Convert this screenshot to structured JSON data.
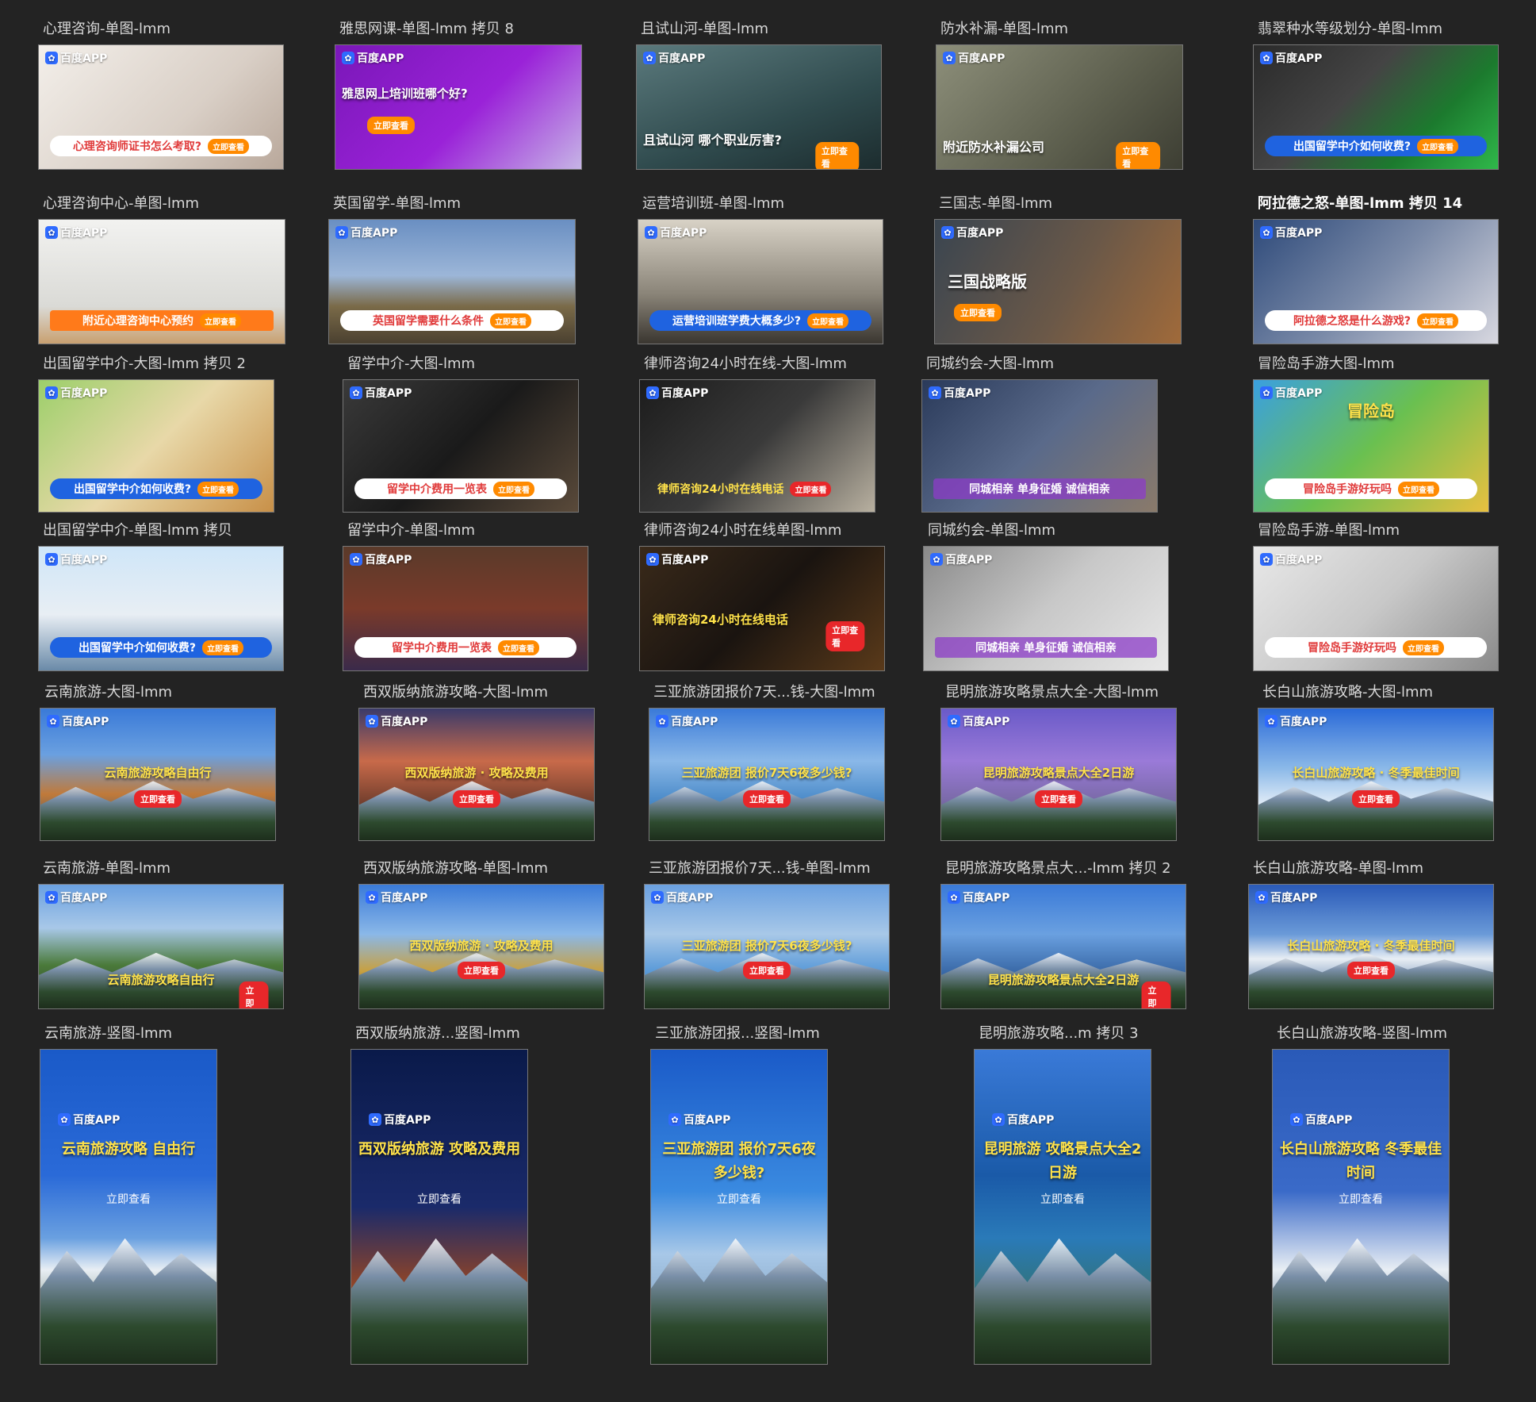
{
  "artboards": [
    {
      "label": "心理咨询-单图-lmm",
      "headline": "",
      "bar_text": "心理咨询师证书怎么考取?",
      "bar_style": "white",
      "cta": "立即查看",
      "bg": "linear-gradient(135deg,#f3efea,#d9cfc6 60%,#b9a89b)"
    },
    {
      "label": "雅思网课-单图-lmm 拷贝 8",
      "headline": "雅思网上培训班哪个好?",
      "bar_text": "",
      "cta": "立即查看",
      "bg": "linear-gradient(135deg,#7a17b8,#9a22d8 55%,#c6b4e6)"
    },
    {
      "label": "且试山河-单图-lmm",
      "headline": "且试山河  哪个职业厉害?",
      "bar_text": "",
      "cta": "立即查看",
      "bg": "linear-gradient(160deg,#5b7a7d,#2f4a4d 60%,#1c2c2e)"
    },
    {
      "label": "防水补漏-单图-lmm",
      "headline": "附近防水补漏公司",
      "bar_text": "",
      "cta": "立即查看",
      "bg": "linear-gradient(135deg,#8d8f7a,#5d5f4e 60%,#3d3e33)"
    },
    {
      "label": "翡翠种水等级划分-单图-lmm",
      "headline": "",
      "bar_text": "出国留学中介如何收费?",
      "bar_style": "blue",
      "cta": "立即查看",
      "bg": "linear-gradient(135deg,#2a2a2a,#444 40%,#1c7a2e 70%,#2fb84a)"
    },
    {
      "label": "心理咨询中心-单图-lmm",
      "headline": "",
      "bar_text": "附近心理咨询中心预约",
      "bar_style": "orange",
      "cta": "立即查看",
      "bg": "linear-gradient(180deg,#f2f2f0,#dadad6 70%,#c8a070)"
    },
    {
      "label": "英国留学-单图-lmm",
      "headline": "",
      "bar_text": "英国留学需要什么条件",
      "bar_style": "white",
      "cta": "立即查看",
      "bg": "linear-gradient(180deg,#6a8fc2,#9cb6d8 45%,#7a6a48 70%,#4a4030)"
    },
    {
      "label": "运营培训班-单图-lmm",
      "headline": "",
      "bar_text": "运营培训班学费大概多少?",
      "bar_style": "blue",
      "cta": "立即查看",
      "bg": "linear-gradient(180deg,#d8d2c6,#8a8478 60%,#3a3630)"
    },
    {
      "label": "三国志-单图-lmm",
      "headline": "三国战略版",
      "bar_text": "",
      "cta": "立即查看",
      "bg": "linear-gradient(120deg,#3a4550,#6a5848 55%,#a06a3a)"
    },
    {
      "label": "阿拉德之怒-单图-lmm 拷贝 14",
      "headline": "",
      "bar_text": "阿拉德之怒是什么游戏?",
      "bar_style": "white",
      "cta": "立即查看",
      "bg": "linear-gradient(135deg,#2e4a7a,#7a8aa8 50%,#d8d8e0)"
    },
    {
      "label": "出国留学中介-大图-lmm 拷贝 2",
      "headline": "",
      "bar_text": "出国留学中介如何收费?",
      "bar_style": "blue",
      "cta": "立即查看",
      "bg": "linear-gradient(135deg,#9ccf6a,#e8d8a8 50%,#c89048)"
    },
    {
      "label": "留学中介-大图-lmm",
      "headline": "",
      "bar_text": "留学中介费用一览表",
      "bar_style": "white",
      "cta": "立即查看",
      "bg": "linear-gradient(135deg,#3a3a3a,#1a1a1a 50%,#5a4a3a)"
    },
    {
      "label": "律师咨询24小时在线-大图-lmm",
      "headline": "",
      "bar_text": "律师咨询24小时在线电话",
      "bar_style": "red",
      "cta": "立即查看",
      "bg": "linear-gradient(135deg,#1c1c1c,#3a3a3a 50%,#b8b0a0)"
    },
    {
      "label": "同城约会-大图-lmm",
      "headline": "",
      "bar_text": "同城相亲  单身征婚  诚信相亲",
      "bar_style": "purple",
      "cta": "",
      "bg": "linear-gradient(135deg,#2a3a5a,#5a6a8a 50%,#8a7a6a)"
    },
    {
      "label": "冒险岛手游大图-lmm",
      "headline": "冒险岛",
      "bar_text": "冒险岛手游好玩吗",
      "bar_style": "white",
      "cta": "立即查看",
      "bg": "linear-gradient(135deg,#3aa0e0,#6ac050 50%,#e8c040)"
    },
    {
      "label": "出国留学中介-单图-lmm 拷贝",
      "headline": "",
      "bar_text": "出国留学中介如何收费?",
      "bar_style": "blue",
      "cta": "立即查看",
      "bg": "linear-gradient(180deg,#cfe6f8,#e8eef4 55%,#6a8aa8)"
    },
    {
      "label": "留学中介-单图-lmm",
      "headline": "",
      "bar_text": "留学中介费用一览表",
      "bar_style": "white",
      "cta": "立即查看",
      "bg": "linear-gradient(180deg,#5a3a2a,#7a3a2a 50%,#3a2a4a)"
    },
    {
      "label": "律师咨询24小时在线单图-lmm",
      "headline": "律师咨询24小时在线电话",
      "bar_text": "",
      "cta": "立即查看",
      "bg": "linear-gradient(135deg,#3a2a1a,#1a1410 50%,#5a3a1a)"
    },
    {
      "label": "同城约会-单图-lmm",
      "headline": "",
      "bar_text": "同城相亲  单身征婚  诚信相亲",
      "bar_style": "purple",
      "cta": "",
      "bg": "linear-gradient(135deg,#8a8a8a,#c8c8c8 50%,#e8e8e8)"
    },
    {
      "label": "冒险岛手游-单图-lmm",
      "headline": "",
      "bar_text": "冒险岛手游好玩吗",
      "bar_style": "white",
      "cta": "立即查看",
      "bg": "linear-gradient(135deg,#e8e8e8,#c8c8c8 50%,#8a8a8a)"
    },
    {
      "label": "云南旅游-大图-lmm",
      "headline": "云南旅游攻略自由行",
      "bar_text": "",
      "cta": "立即查看",
      "bg": "linear-gradient(180deg,#3a7ad8,#6aa0e0 35%,#c07a3a 65%,#2a4a6a)"
    },
    {
      "label": "西双版纳旅游攻略-大图-lmm",
      "headline": "西双版纳旅游 · 攻略及费用",
      "bar_text": "",
      "cta": "立即查看",
      "bg": "linear-gradient(180deg,#3a3a6a,#c86a4a 40%,#6a3a2a 75%,#2a1a1a)"
    },
    {
      "label": "三亚旅游团报价7天...钱-大图-lmm",
      "headline": "三亚旅游团 报价7天6夜多少钱?",
      "bar_text": "",
      "cta": "立即查看",
      "bg": "linear-gradient(180deg,#3a7ad8,#8ab8e8 40%,#4a8ac8 70%,#2a5a8a)"
    },
    {
      "label": "昆明旅游攻略景点大全-大图-lmm",
      "headline": "昆明旅游攻略景点大全2日游",
      "bar_text": "",
      "cta": "立即查看",
      "bg": "linear-gradient(180deg,#6a5ac8,#9a7ad8 40%,#7a6aa8 70%,#3a3a4a)"
    },
    {
      "label": "长白山旅游攻略-大图-lmm",
      "headline": "长白山旅游攻略 · 冬季最佳时间",
      "bar_text": "",
      "cta": "立即查看",
      "bg": "linear-gradient(180deg,#2a6ad8,#8ab8e8 45%,#e8f0f8 75%,#c8d8e8)"
    },
    {
      "label": "云南旅游-单图-lmm",
      "headline": "云南旅游攻略自由行",
      "bar_text": "",
      "cta": "立即查看",
      "bg": "linear-gradient(180deg,#6aa0e0,#a8c8e8 35%,#4a7a3a 65%,#2a3a2a)"
    },
    {
      "label": "西双版纳旅游攻略-单图-lmm",
      "headline": "西双版纳旅游 · 攻略及费用",
      "bar_text": "",
      "cta": "立即查看",
      "bg": "linear-gradient(180deg,#3a7ad8,#8ab8e8 40%,#c8a040 70%,#4a3a2a)"
    },
    {
      "label": "三亚旅游团报价7天...钱-单图-lmm",
      "headline": "三亚旅游团 报价7天6夜多少钱?",
      "bar_text": "",
      "cta": "立即查看",
      "bg": "linear-gradient(180deg,#6aa0e0,#a8c8e8 40%,#5a9ad8 70%,#3a6a9a)"
    },
    {
      "label": "昆明旅游攻略景点大...-lmm 拷贝 2",
      "headline": "昆明旅游攻略景点大全2日游",
      "bar_text": "",
      "cta": "立即查看",
      "bg": "linear-gradient(180deg,#3a7ad8,#6aa0e0 40%,#3a6aa8 70%,#1a3a6a)"
    },
    {
      "label": "长白山旅游攻略-单图-lmm",
      "headline": "长白山旅游攻略 · 冬季最佳时间",
      "bar_text": "",
      "cta": "立即查看",
      "bg": "linear-gradient(180deg,#2a5ab8,#6a9ad8 40%,#e8eef4 60%,#1a4a8a)"
    },
    {
      "label": "云南旅游-竖图-lmm",
      "headline": "云南旅游攻略 自由行",
      "cta": "立即查看",
      "bg": "linear-gradient(180deg,#1a5ac8,#2a6ad8 40%,#6aa0e0 60%,#e8eef4 70%,#2a4a2a)"
    },
    {
      "label": "西双版纳旅游...竖图-lmm",
      "headline": "西双版纳旅游 攻略及费用",
      "cta": "立即查看",
      "bg": "linear-gradient(180deg,#0a1a4a,#1a2a6a 50%,#a84a1a 80%,#2a1a0a)"
    },
    {
      "label": "三亚旅游团报...竖图-lmm",
      "headline": "三亚旅游团 报价7天6夜多少钱?",
      "cta": "立即查看",
      "bg": "linear-gradient(180deg,#1a5ac8,#3a8ae0 45%,#a8c8e8 65%,#6a8aa8)"
    },
    {
      "label": "昆明旅游攻略...m 拷贝 3",
      "headline": "昆明旅游 攻略景点大全2日游",
      "cta": "立即查看",
      "bg": "linear-gradient(180deg,#3a7ad8,#1a5aa8 40%,#2a7ab8 60%,#3a6a2a)"
    },
    {
      "label": "长白山旅游攻略-竖图-lmm",
      "headline": "长白山旅游攻略 冬季最佳时间",
      "cta": "立即查看",
      "bg": "linear-gradient(180deg,#2a5ab8,#3a6ac8 45%,#e8eef4 70%,#2a4a7a)"
    }
  ],
  "selected_index": 9,
  "brand": "百度APP",
  "paw_glyph": "✿"
}
